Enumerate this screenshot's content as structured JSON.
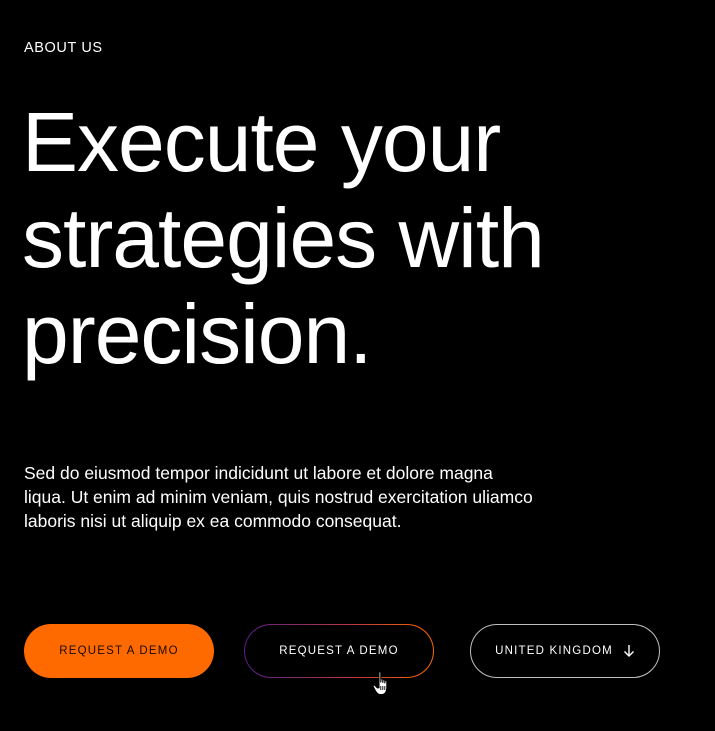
{
  "eyebrow": "ABOUT US",
  "headline": {
    "line1": "Execute your",
    "line2": "strategies with",
    "line3": "precision."
  },
  "body": {
    "line1": "Sed do eiusmod tempor indicidunt ut labore et dolore magna",
    "line2": "liqua. Ut enim ad minim veniam, quis nostrud exercitation uliamco",
    "line3": "laboris nisi ut aliquip ex ea commodo consequat."
  },
  "buttons": {
    "primary_label": "REQUEST A DEMO",
    "secondary_label": "REQUEST A DEMO",
    "country_label": "UNITED KINGDOM",
    "country_icon": "arrow-down-icon"
  },
  "colors": {
    "background": "#000000",
    "accent": "#ff6a00",
    "text": "#ffffff"
  }
}
